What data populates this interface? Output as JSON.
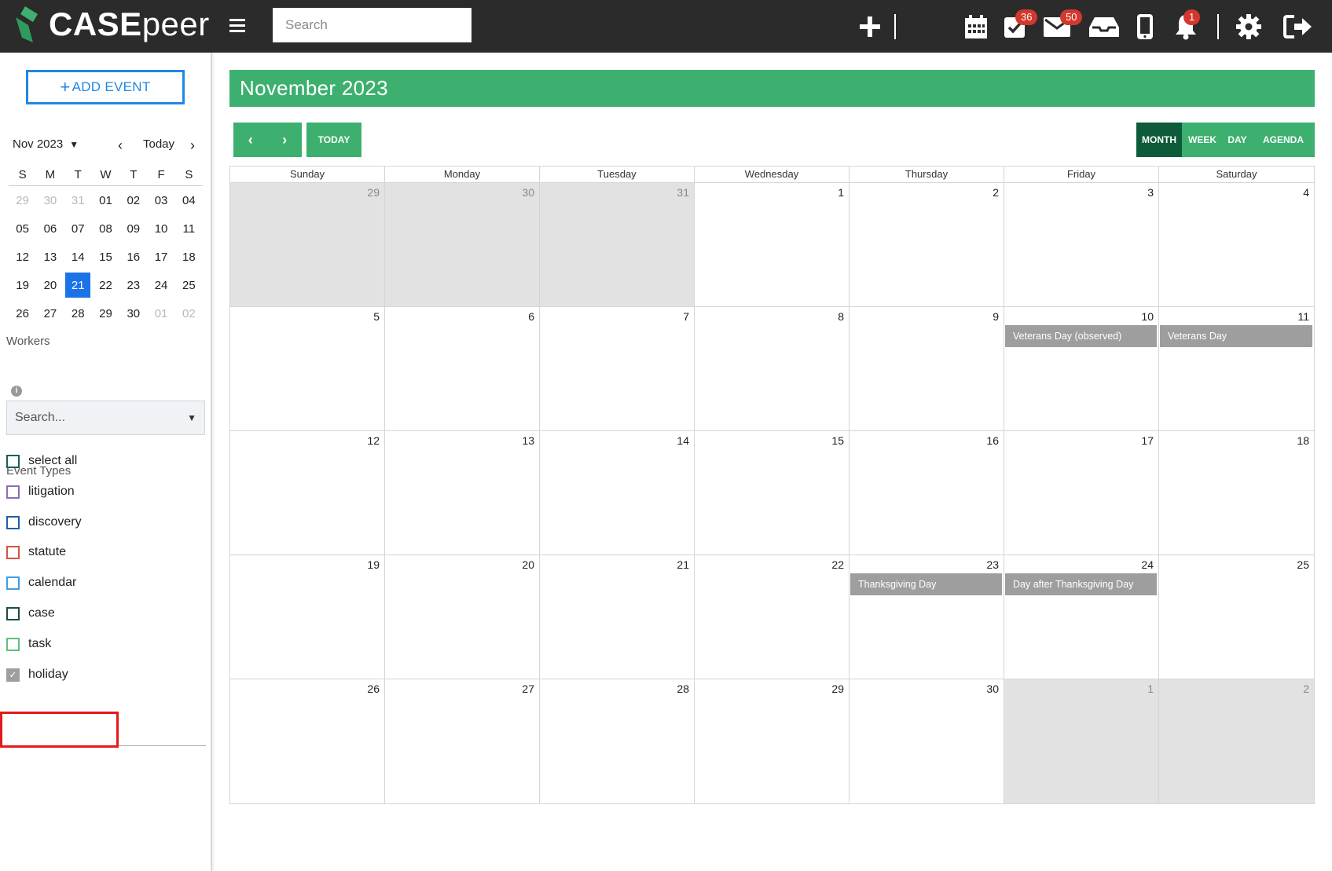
{
  "topbar": {
    "logo_text_bold": "CASE",
    "logo_text_light": "peer",
    "search_placeholder": "Search",
    "badges": {
      "tasks": "36",
      "mail": "50",
      "notifications": "1"
    }
  },
  "sidebar": {
    "add_event_label": "ADD EVENT",
    "mini_calendar": {
      "month_label": "Nov 2023",
      "today_label": "Today",
      "dows": [
        "S",
        "M",
        "T",
        "W",
        "T",
        "F",
        "S"
      ],
      "weeks": [
        [
          {
            "d": "29",
            "o": true
          },
          {
            "d": "30",
            "o": true
          },
          {
            "d": "31",
            "o": true
          },
          {
            "d": "01"
          },
          {
            "d": "02"
          },
          {
            "d": "03"
          },
          {
            "d": "04"
          }
        ],
        [
          {
            "d": "05"
          },
          {
            "d": "06"
          },
          {
            "d": "07"
          },
          {
            "d": "08"
          },
          {
            "d": "09"
          },
          {
            "d": "10"
          },
          {
            "d": "11"
          }
        ],
        [
          {
            "d": "12"
          },
          {
            "d": "13"
          },
          {
            "d": "14"
          },
          {
            "d": "15"
          },
          {
            "d": "16"
          },
          {
            "d": "17"
          },
          {
            "d": "18"
          }
        ],
        [
          {
            "d": "19"
          },
          {
            "d": "20"
          },
          {
            "d": "21",
            "sel": true
          },
          {
            "d": "22"
          },
          {
            "d": "23"
          },
          {
            "d": "24"
          },
          {
            "d": "25"
          }
        ],
        [
          {
            "d": "26"
          },
          {
            "d": "27"
          },
          {
            "d": "28"
          },
          {
            "d": "29"
          },
          {
            "d": "30"
          },
          {
            "d": "01",
            "o": true
          },
          {
            "d": "02",
            "o": true
          }
        ]
      ]
    },
    "workers_label": "Workers",
    "workers_placeholder": "Search...",
    "event_types_label": "Event Types",
    "event_types": [
      {
        "label": "select all",
        "color": "#1b5e5a",
        "checked": false
      },
      {
        "label": "litigation",
        "color": "#8e6bb8",
        "checked": false
      },
      {
        "label": "discovery",
        "color": "#1f5fa8",
        "checked": false
      },
      {
        "label": "statute",
        "color": "#d1553f",
        "checked": false
      },
      {
        "label": "calendar",
        "color": "#3c9ee5",
        "checked": false
      },
      {
        "label": "case",
        "color": "#1d4f3c",
        "checked": false
      },
      {
        "label": "task",
        "color": "#5fbf7a",
        "checked": false
      },
      {
        "label": "holiday",
        "color": "#9e9e9e",
        "checked": true
      }
    ]
  },
  "calendar": {
    "title": "November 2023",
    "today_label": "TODAY",
    "views": [
      {
        "label": "MONTH",
        "active": true
      },
      {
        "label": "WEEK",
        "active": false
      },
      {
        "label": "DAY",
        "active": false
      },
      {
        "label": "AGENDA",
        "active": false
      }
    ],
    "dows": [
      "Sunday",
      "Monday",
      "Tuesday",
      "Wednesday",
      "Thursday",
      "Friday",
      "Saturday"
    ],
    "weeks": [
      [
        {
          "d": "29",
          "o": true
        },
        {
          "d": "30",
          "o": true
        },
        {
          "d": "31",
          "o": true
        },
        {
          "d": "1"
        },
        {
          "d": "2"
        },
        {
          "d": "3"
        },
        {
          "d": "4"
        }
      ],
      [
        {
          "d": "5"
        },
        {
          "d": "6"
        },
        {
          "d": "7"
        },
        {
          "d": "8"
        },
        {
          "d": "9"
        },
        {
          "d": "10",
          "ev": "Veterans Day (observed)"
        },
        {
          "d": "11",
          "ev": "Veterans Day"
        }
      ],
      [
        {
          "d": "12"
        },
        {
          "d": "13"
        },
        {
          "d": "14"
        },
        {
          "d": "15"
        },
        {
          "d": "16"
        },
        {
          "d": "17"
        },
        {
          "d": "18"
        }
      ],
      [
        {
          "d": "19"
        },
        {
          "d": "20"
        },
        {
          "d": "21"
        },
        {
          "d": "22"
        },
        {
          "d": "23",
          "ev": "Thanksgiving Day"
        },
        {
          "d": "24",
          "ev": "Day after Thanksgiving Day"
        },
        {
          "d": "25"
        }
      ],
      [
        {
          "d": "26"
        },
        {
          "d": "27"
        },
        {
          "d": "28"
        },
        {
          "d": "29"
        },
        {
          "d": "30"
        },
        {
          "d": "1",
          "o": true
        },
        {
          "d": "2",
          "o": true
        }
      ]
    ]
  },
  "colors": {
    "brand_green": "#3daf6f",
    "dark_green": "#0e5b3a",
    "accent_blue": "#1e88e5",
    "highlight_red": "#e3191c"
  }
}
